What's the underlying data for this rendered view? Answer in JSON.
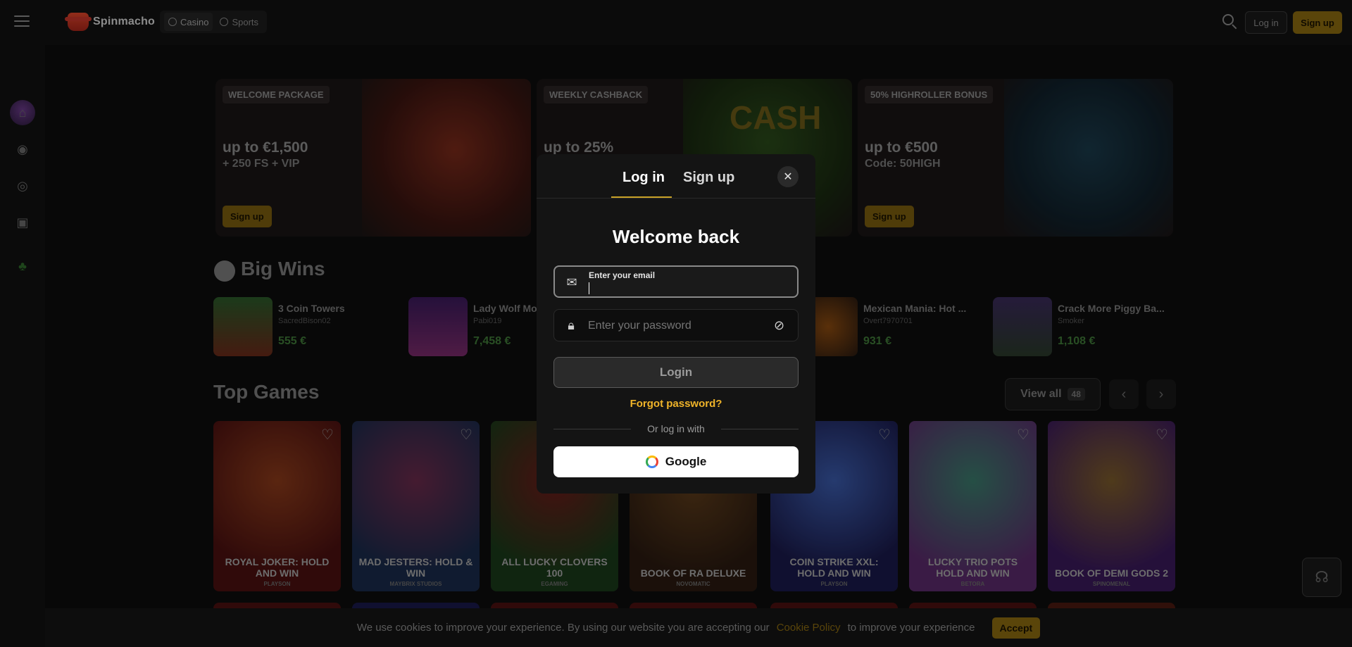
{
  "header": {
    "brand": "Spinmacho",
    "tabs": [
      {
        "label": "Casino",
        "icon": "casino-icon"
      },
      {
        "label": "Sports",
        "icon": "sports-icon"
      }
    ],
    "login_label": "Log in",
    "signup_label": "Sign up",
    "accent": "#c9a227"
  },
  "rail": {
    "icons": [
      "avatar",
      "casino-icon",
      "live-icon",
      "sports-icon",
      "games-icon",
      "clover-icon"
    ]
  },
  "banners": [
    {
      "tag": "WELCOME PACKAGE",
      "headline": "up to €1,500",
      "sub": "+ 250 FS + VIP",
      "cta": "Sign up"
    },
    {
      "tag": "WEEKLY CASHBACK",
      "headline": "up to 25%",
      "art_text": "CASH"
    },
    {
      "tag": "50% HIGHROLLER BONUS",
      "headline": "up to €500",
      "sub": "Code: 50HIGH",
      "cta": "Sign up"
    }
  ],
  "big_wins": {
    "title": "Big Wins",
    "items": [
      {
        "game": "3 Coin Towers",
        "user": "SacredBison02",
        "amount": "555 €"
      },
      {
        "game": "Lady Wolf Mo",
        "user": "Pabi019",
        "amount": "7,458 €"
      },
      {
        "game": "Mexican Mania: Hot ...",
        "user": "Overt7970701",
        "amount": "931 €"
      },
      {
        "game": "Crack More Piggy Ba...",
        "user": "Smoker",
        "amount": "1,108 €"
      }
    ]
  },
  "top_games": {
    "title": "Top Games",
    "view_all_label": "View all",
    "view_all_count": "48",
    "games": [
      {
        "title": "ROYAL JOKER: HOLD AND WIN",
        "studio": "PLAYSON"
      },
      {
        "title": "MAD JESTERS: HOLD & WIN",
        "studio": "MAYBRIX STUDIOS"
      },
      {
        "title": "ALL LUCKY CLOVERS 100",
        "studio": "EGAMING"
      },
      {
        "title": "BOOK OF RA DELUXE",
        "studio": "NOVOMATIC"
      },
      {
        "title": "COIN STRIKE XXL: HOLD AND WIN",
        "studio": "PLAYSON"
      },
      {
        "title": "LUCKY TRIO POTS HOLD AND WIN",
        "studio": "BETORA"
      },
      {
        "title": "BOOK OF DEMI GODS 2",
        "studio": "SPINOMENAL"
      }
    ]
  },
  "cookie": {
    "text_before": "We use cookies to improve your experience. By using our website you are accepting our",
    "link": "Cookie Policy",
    "text_after": "to improve your experience",
    "accept": "Accept"
  },
  "modal": {
    "tab_login": "Log in",
    "tab_signup": "Sign up",
    "title": "Welcome back",
    "email_label": "Enter your email",
    "email_value": "",
    "password_placeholder": "Enter your password",
    "login_button": "Login",
    "forgot": "Forgot password?",
    "or_text": "Or log in with",
    "google": "Google"
  }
}
